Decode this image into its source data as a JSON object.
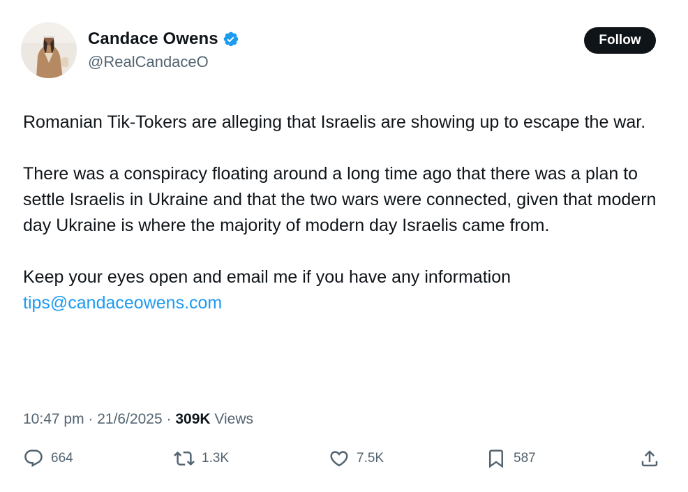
{
  "author": {
    "display_name": "Candace Owens",
    "handle": "@RealCandaceO",
    "verified": true,
    "verified_color": "#1d9bf0"
  },
  "follow_label": "Follow",
  "tweet": {
    "para1": "Romanian Tik-Tokers are alleging that Israelis are showing up to escape the war.",
    "para2": "There was a conspiracy floating around a long time ago that there was a plan to settle Israelis in Ukraine and that the two wars were connected, given that modern day Ukraine is where the majority of modern day Israelis came from.",
    "para3": "Keep your eyes open and email me if you have any information",
    "email_link": "tips@candaceowens.com"
  },
  "meta": {
    "time": "10:47 pm",
    "separator": " · ",
    "date": "21/6/2025",
    "views_count": "309K",
    "views_label": " Views"
  },
  "actions": {
    "replies": "664",
    "reposts": "1.3K",
    "likes": "7.5K",
    "bookmarks": "587"
  },
  "colors": {
    "text": "#0f1419",
    "secondary": "#536471",
    "link": "#1d9bf0",
    "follow_bg": "#0f1419"
  }
}
